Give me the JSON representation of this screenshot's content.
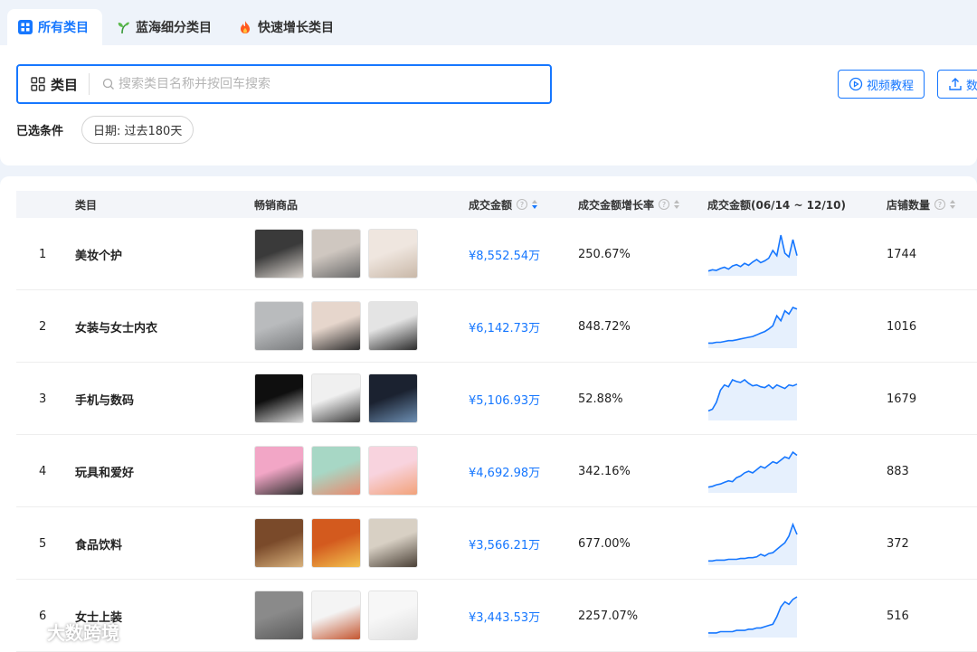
{
  "tabs": [
    {
      "label": "所有类目",
      "icon": "grid-icon",
      "active": true
    },
    {
      "label": "蓝海细分类目",
      "icon": "sprout-icon",
      "active": false
    },
    {
      "label": "快速增长类目",
      "icon": "fire-icon",
      "active": false
    }
  ],
  "search": {
    "category_label": "类目",
    "placeholder": "搜索类目名称并按回车搜索"
  },
  "buttons": {
    "video_tutorial": "视频教程",
    "export": "数"
  },
  "conditions": {
    "label": "已选条件",
    "chip": "日期: 过去180天"
  },
  "table": {
    "headers": {
      "category": "类目",
      "best_sellers": "畅销商品",
      "gmv": "成交金额",
      "growth": "成交金额增长率",
      "trend": "成交金额(06/14 ~ 12/10)",
      "shops": "店铺数量"
    },
    "rows": [
      {
        "rank": "1",
        "name": "美妆个护",
        "gmv": "¥8,552.54万",
        "growth": "250.67%",
        "shops": "1744",
        "trend": [
          6,
          8,
          7,
          10,
          12,
          9,
          14,
          16,
          13,
          18,
          15,
          20,
          24,
          19,
          22,
          26,
          38,
          30,
          62,
          34,
          28,
          55,
          30
        ]
      },
      {
        "rank": "2",
        "name": "女装与女士内衣",
        "gmv": "¥6,142.73万",
        "growth": "848.72%",
        "shops": "1016",
        "trend": [
          5,
          5,
          6,
          6,
          7,
          8,
          8,
          9,
          10,
          11,
          12,
          13,
          15,
          17,
          19,
          22,
          26,
          38,
          32,
          44,
          40,
          48,
          46
        ]
      },
      {
        "rank": "3",
        "name": "手机与数码",
        "gmv": "¥5,106.93万",
        "growth": "52.88%",
        "shops": "1679",
        "trend": [
          10,
          12,
          20,
          34,
          40,
          38,
          46,
          44,
          43,
          46,
          42,
          39,
          40,
          38,
          37,
          40,
          36,
          40,
          38,
          36,
          40,
          39,
          41
        ]
      },
      {
        "rank": "4",
        "name": "玩具和爱好",
        "gmv": "¥4,692.98万",
        "growth": "342.16%",
        "shops": "883",
        "trend": [
          6,
          7,
          9,
          10,
          12,
          14,
          13,
          18,
          20,
          24,
          26,
          24,
          28,
          32,
          30,
          34,
          38,
          36,
          40,
          44,
          42,
          50,
          46
        ]
      },
      {
        "rank": "5",
        "name": "食品饮料",
        "gmv": "¥3,566.21万",
        "growth": "677.00%",
        "shops": "372",
        "trend": [
          4,
          4,
          5,
          5,
          5,
          6,
          6,
          6,
          7,
          7,
          8,
          8,
          9,
          12,
          10,
          13,
          14,
          18,
          22,
          26,
          34,
          48,
          36
        ]
      },
      {
        "rank": "6",
        "name": "女士上装",
        "gmv": "¥3,443.53万",
        "growth": "2257.07%",
        "shops": "516",
        "trend": [
          3,
          3,
          3,
          4,
          4,
          4,
          4,
          5,
          5,
          5,
          6,
          6,
          7,
          7,
          8,
          9,
          10,
          16,
          24,
          28,
          26,
          30,
          32
        ]
      }
    ]
  },
  "watermark": "大数跨境",
  "colors": {
    "accent": "#1677ff",
    "spark_fill": "#e6f0fd"
  }
}
